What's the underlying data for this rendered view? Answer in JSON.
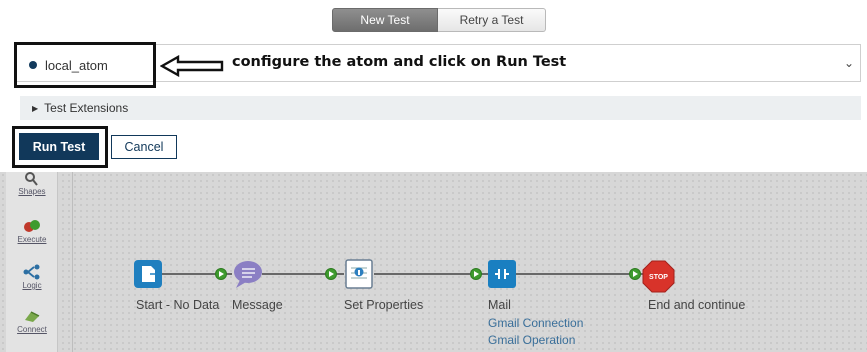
{
  "mode_tabs": {
    "new_test": "New Test",
    "retry_test": "Retry a Test"
  },
  "atom_selector": {
    "selected": "local_atom",
    "caret": "⌄"
  },
  "annotation": {
    "text": "configure the atom and click on Run Test"
  },
  "test_extensions": {
    "label": "Test Extensions"
  },
  "actions": {
    "run_test": "Run Test",
    "cancel": "Cancel"
  },
  "palette": {
    "items": [
      {
        "label": "Shapes",
        "icon": "magnifier-icon"
      },
      {
        "label": "Execute",
        "icon": "execute-icon"
      },
      {
        "label": "Logic",
        "icon": "logic-icon"
      },
      {
        "label": "Connect",
        "icon": "connect-icon"
      }
    ]
  },
  "process": {
    "shapes": [
      {
        "label": "Start - No Data",
        "icon": "start-icon"
      },
      {
        "label": "Message",
        "icon": "message-icon"
      },
      {
        "label": "Set Properties",
        "icon": "set-properties-icon"
      },
      {
        "label": "Mail",
        "icon": "mail-connector-icon",
        "sub": [
          "Gmail Connection",
          "Gmail Operation"
        ]
      },
      {
        "label": "End and continue",
        "icon": "stop-icon",
        "badge": "STOP"
      }
    ]
  },
  "colors": {
    "navy": "#11385a",
    "shape_blue": "#1f7fbf",
    "connector_green": "#3e9b2e",
    "stop_red": "#d8332a",
    "link_blue": "#3a6f9a"
  }
}
